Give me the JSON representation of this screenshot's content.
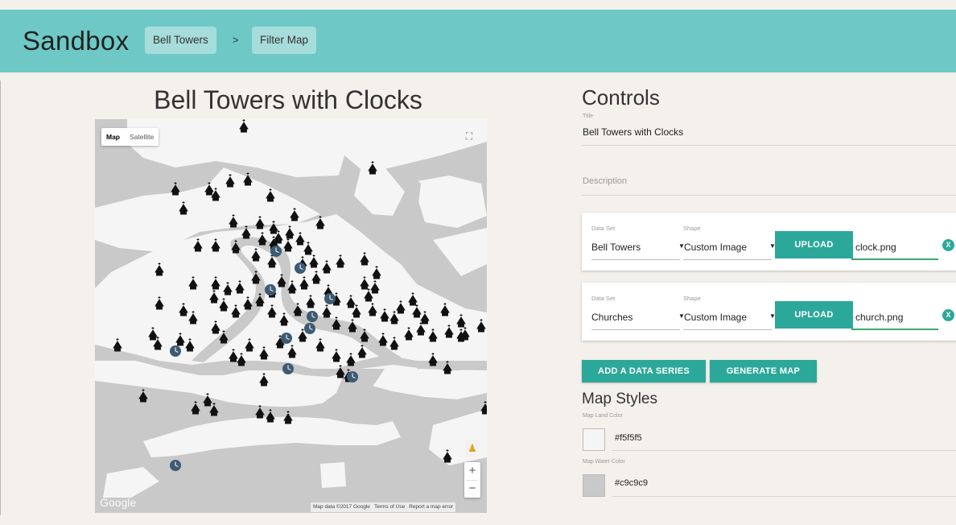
{
  "header": {
    "brand": "Sandbox",
    "breadcrumb": [
      "Bell Towers",
      "Filter Map"
    ],
    "separator": ">"
  },
  "map_panel": {
    "title": "Bell Towers with Clocks",
    "map_type_buttons": [
      "Map",
      "Satellite"
    ],
    "active_map_type": "Map",
    "logo": "Google",
    "attribution": [
      "Map data ©2017 Google",
      "Terms of Use",
      "Report a map error"
    ],
    "zoom_in": "+",
    "zoom_out": "−",
    "fullscreen_icon": "fullscreen-icon",
    "pegman_icon": "pegman-icon",
    "markers": {
      "church_icon": "church-icon",
      "clock_icon": "clock-icon",
      "church_count": 120,
      "clock_count": 11
    }
  },
  "controls": {
    "heading": "Controls",
    "title_label": "Title",
    "title_value": "Bell Towers with Clocks",
    "description_placeholder": "Description",
    "data_series": [
      {
        "data_set_label": "Data Set",
        "data_set_value": "Bell Towers",
        "shape_label": "Shape",
        "shape_value": "Custom Image",
        "upload_label": "UPLOAD",
        "file_name": "clock.png",
        "remove_label": "X"
      },
      {
        "data_set_label": "Data Set",
        "data_set_value": "Churches",
        "shape_label": "Shape",
        "shape_value": "Custom Image",
        "upload_label": "UPLOAD",
        "file_name": "church.png",
        "remove_label": "X"
      }
    ],
    "add_series_label": "ADD A DATA SERIES",
    "generate_label": "GENERATE MAP",
    "styles_heading": "Map Styles",
    "land_color_label": "Map Land Color",
    "land_color_value": "#f5f5f5",
    "water_color_label": "Map Water Color",
    "water_color_value": "#c9c9c9"
  },
  "colors": {
    "header_bg": "#6ec9c6",
    "crumb_bg": "#a6dcd9",
    "accent": "#2ca89a",
    "input_focus": "#3aaa6d",
    "clock_marker": "#3d5a73"
  }
}
